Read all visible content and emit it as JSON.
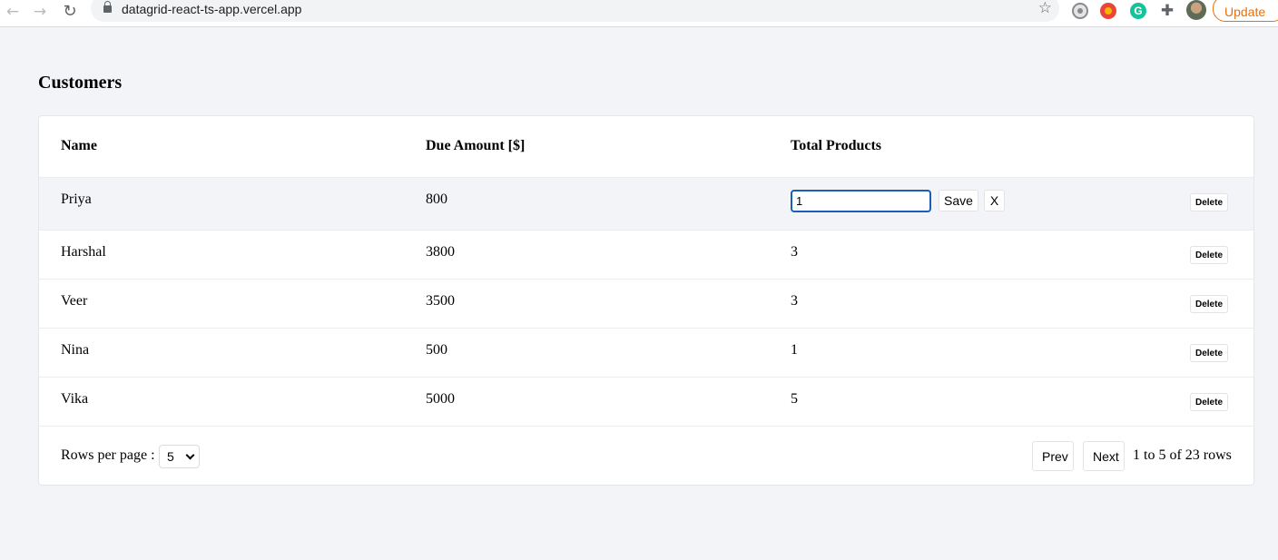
{
  "browser": {
    "url": "datagrid-react-ts-app.vercel.app",
    "update_label": "Update",
    "icons": [
      "back-arrow-icon",
      "forward-arrow-icon",
      "reload-icon",
      "lock-icon",
      "star-icon",
      "extension-icon",
      "puzzle-icon",
      "avatar"
    ]
  },
  "page": {
    "title": "Customers"
  },
  "table": {
    "columns": [
      "Name",
      "Due Amount [$]",
      "Total Products"
    ],
    "editing_row": {
      "name": "Priya",
      "due_amount": "800",
      "input_value": "1",
      "save_label": "Save",
      "cancel_label": "X",
      "delete_label": "Delete"
    },
    "rows": [
      {
        "name": "Harshal",
        "due_amount": "3800",
        "total_products": "3",
        "delete_label": "Delete"
      },
      {
        "name": "Veer",
        "due_amount": "3500",
        "total_products": "3",
        "delete_label": "Delete"
      },
      {
        "name": "Nina",
        "due_amount": "500",
        "total_products": "1",
        "delete_label": "Delete"
      },
      {
        "name": "Vika",
        "due_amount": "5000",
        "total_products": "5",
        "delete_label": "Delete"
      }
    ]
  },
  "pagination": {
    "rows_per_page_label": "Rows per page :",
    "rows_per_page_value": "5",
    "prev_label": "Prev",
    "next_label": "Next",
    "range_text": "1 to 5 of 23 rows"
  },
  "colors": {
    "page_bg": "#f3f4f7",
    "focus_border": "#1a5fb4",
    "update_accent": "#e8710a"
  }
}
